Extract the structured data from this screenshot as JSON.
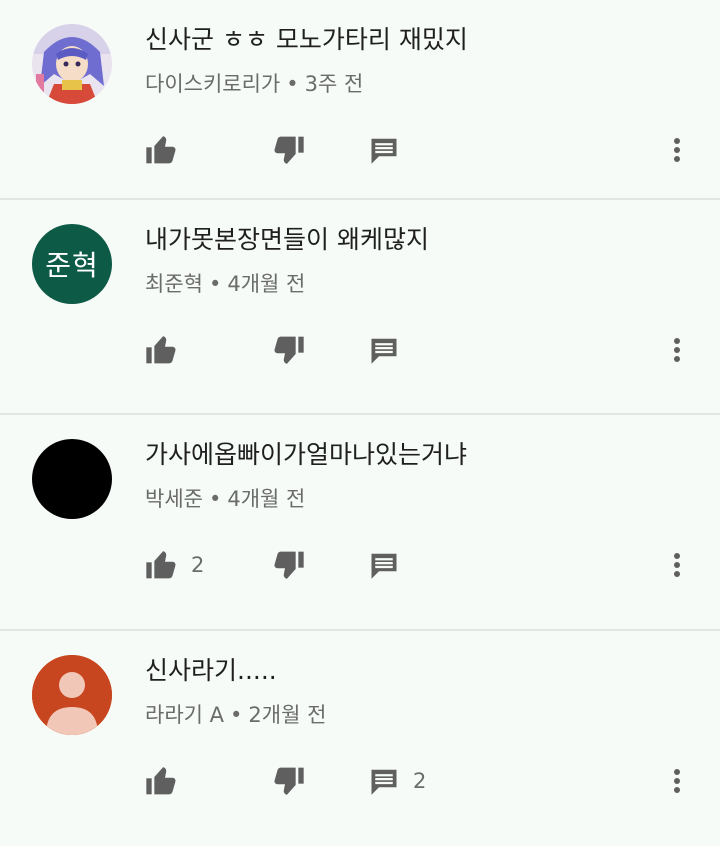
{
  "comments": [
    {
      "text": "신사군 ㅎㅎ 모노가타리 재밌지",
      "author": "다이스키로리가",
      "time": "3주 전",
      "separator": "•",
      "likes": "",
      "replies": "",
      "avatar_type": "anime-image"
    },
    {
      "text": "내가못본장면들이 왜케많지",
      "author": "최준혁",
      "time": "4개월 전",
      "separator": "•",
      "likes": "",
      "replies": "",
      "avatar_type": "initials",
      "avatar_initials": "준혁",
      "avatar_color": "#0d5a47"
    },
    {
      "text": "가사에옵빠이가얼마나있는거냐",
      "author": "박세준",
      "time": "4개월 전",
      "separator": "•",
      "likes": "2",
      "replies": "",
      "avatar_type": "black",
      "avatar_color": "#000000"
    },
    {
      "text": "신사라기.....",
      "author": "라라기 A",
      "time": "2개월 전",
      "separator": "•",
      "likes": "",
      "replies": "2",
      "avatar_type": "default-person",
      "avatar_color": "#c8461f"
    }
  ],
  "icons": {
    "like": "thumb-up-icon",
    "dislike": "thumb-down-icon",
    "reply": "comment-icon",
    "more": "more-vert-icon"
  },
  "colors": {
    "background": "#f7fbf7",
    "icon": "#5f5f5f",
    "meta_text": "#6b6b6b"
  }
}
